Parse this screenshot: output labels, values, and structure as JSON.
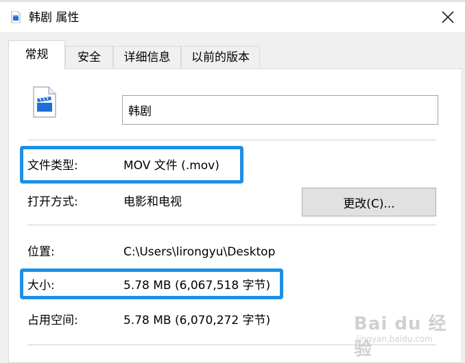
{
  "window": {
    "title": "韩剧 属性",
    "title_icon": "video-file-icon",
    "close_icon": "close-icon"
  },
  "tabs": [
    {
      "label": "常规",
      "active": true
    },
    {
      "label": "安全",
      "active": false
    },
    {
      "label": "详细信息",
      "active": false
    },
    {
      "label": "以前的版本",
      "active": false
    }
  ],
  "general": {
    "file_icon": "video-file-icon",
    "file_name": "韩剧",
    "file_type_label": "文件类型:",
    "file_type_value": "MOV 文件 (.mov)",
    "opens_with_label": "打开方式:",
    "opens_with_value": "电影和电视",
    "change_button_label": "更改(C)...",
    "location_label": "位置:",
    "location_value": "C:\\Users\\lirongyu\\Desktop",
    "size_label": "大小:",
    "size_value": "5.78 MB (6,067,518 字节)",
    "size_on_disk_label": "占用空间:",
    "size_on_disk_value": "5.78 MB (6,070,272 字节)"
  },
  "watermark": {
    "text": "Bai du 经验",
    "subtext": "jingyan.baidu.com"
  },
  "colors": {
    "highlight": "#1e8fe6",
    "icon_blue": "#1e6fd9"
  }
}
